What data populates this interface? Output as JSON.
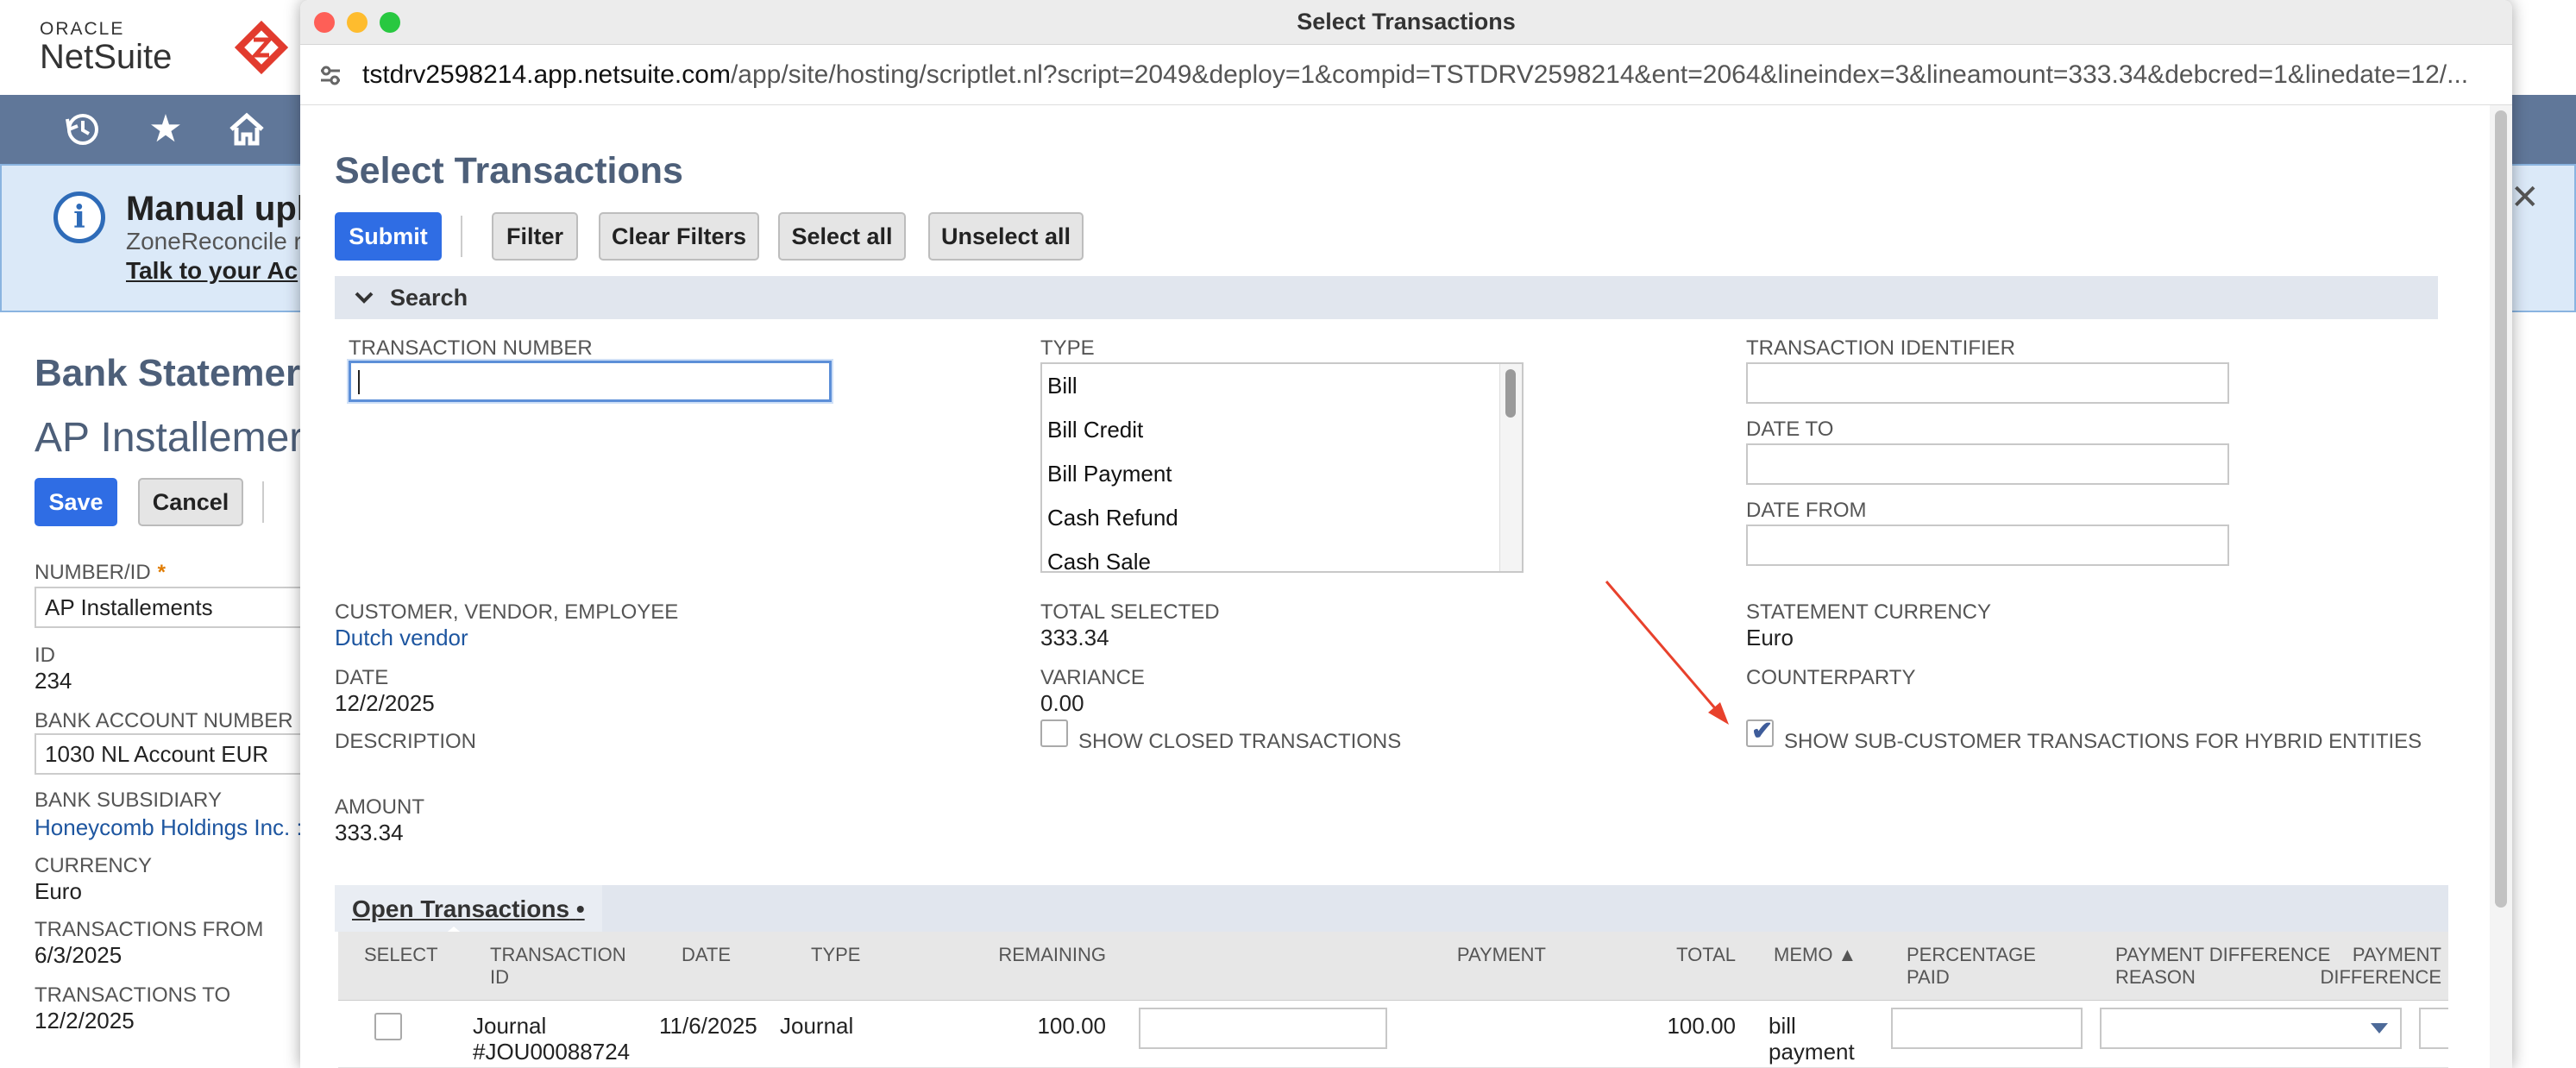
{
  "background": {
    "logo": {
      "oracle": "ORACLE",
      "netsuite": "NetSuite"
    },
    "nav_icons": [
      "recent-icon",
      "star-icon",
      "home-icon"
    ],
    "banner": {
      "title": "Manual upl",
      "subtitle": "ZoneReconcile r",
      "link": "Talk to your Ac"
    },
    "record_title": "Bank Statemer",
    "record_subtitle": "AP Installemer",
    "save_label": "Save",
    "cancel_label": "Cancel",
    "fields": {
      "number_label": "NUMBER/ID",
      "number_required": "*",
      "number_value": "AP Installements",
      "id_label": "ID",
      "id_value": "234",
      "bank_account_label": "BANK ACCOUNT NUMBER",
      "bank_account_value": "1030 NL Account EUR",
      "subsidiary_label": "BANK SUBSIDIARY",
      "subsidiary_value": "Honeycomb Holdings Inc. :",
      "currency_label": "CURRENCY",
      "currency_value": "Euro",
      "from_label": "TRANSACTIONS FROM",
      "from_value": "6/3/2025",
      "to_label": "TRANSACTIONS TO",
      "to_value": "12/2/2025"
    }
  },
  "window": {
    "title": "Select Transactions",
    "url_host": "tstdrv2598214.app.netsuite.com",
    "url_path": "/app/site/hosting/scriptlet.nl?script=2049&deploy=1&compid=TSTDRV2598214&ent=2064&lineindex=3&lineamount=333.34&debcred=1&linedate=12/..."
  },
  "page": {
    "title": "Select Transactions",
    "buttons": {
      "submit": "Submit",
      "filter": "Filter",
      "clear_filters": "Clear Filters",
      "select_all": "Select all",
      "unselect_all": "Unselect all"
    },
    "search_section": "Search",
    "fields": {
      "transaction_number_label": "TRANSACTION NUMBER",
      "transaction_number_value": "",
      "type_label": "TYPE",
      "type_options": [
        "Bill",
        "Bill Credit",
        "Bill Payment",
        "Cash Refund",
        "Cash Sale"
      ],
      "transaction_identifier_label": "TRANSACTION IDENTIFIER",
      "date_to_label": "DATE TO",
      "date_from_label": "DATE FROM",
      "cve_label": "CUSTOMER, VENDOR, EMPLOYEE",
      "cve_value": "Dutch vendor",
      "total_selected_label": "TOTAL SELECTED",
      "total_selected_value": "333.34",
      "statement_currency_label": "STATEMENT CURRENCY",
      "statement_currency_value": "Euro",
      "date_label": "DATE",
      "date_value": "12/2/2025",
      "variance_label": "VARIANCE",
      "variance_value": "0.00",
      "counterparty_label": "COUNTERPARTY",
      "description_label": "DESCRIPTION",
      "show_closed_label": "SHOW CLOSED TRANSACTIONS",
      "show_closed_checked": false,
      "show_subcustomer_label": "SHOW SUB-CUSTOMER TRANSACTIONS FOR HYBRID ENTITIES",
      "show_subcustomer_checked": true,
      "amount_label": "AMOUNT",
      "amount_value": "333.34"
    },
    "tab": {
      "label": "Open Transactions",
      "marker": "•"
    },
    "table": {
      "headers": {
        "select": "SELECT",
        "transaction_id_1": "TRANSACTION",
        "transaction_id_2": "ID",
        "date": "DATE",
        "type": "TYPE",
        "remaining": "REMAINING",
        "payment": "PAYMENT",
        "total": "TOTAL",
        "memo": "MEMO ▲",
        "percentage_paid_1": "PERCENTAGE",
        "percentage_paid_2": "PAID",
        "pdr_1": "PAYMENT DIFFERENCE",
        "pdr_2": "REASON",
        "payment_difference_1": "PAYMENT",
        "payment_difference_2": "DIFFERENCE"
      },
      "rows": [
        {
          "transaction_id_1": "Journal",
          "transaction_id_2": "#JOU00088724",
          "date": "11/6/2025",
          "type": "Journal",
          "remaining": "100.00",
          "total": "100.00",
          "memo_1": "bill",
          "memo_2": "payment"
        }
      ]
    }
  },
  "colors": {
    "accent": "#2f6de4",
    "nav": "#607799",
    "title": "#4d5f79",
    "annotation_arrow": "#e8412c"
  }
}
